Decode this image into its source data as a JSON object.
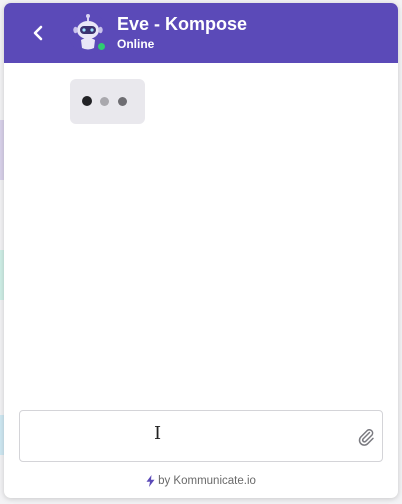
{
  "colors": {
    "header_bg": "#5b4ab8",
    "online": "#2ecc71"
  },
  "header": {
    "back_icon": "chevron-left-icon",
    "avatar_icon": "robot-icon",
    "title": "Eve - Kompose",
    "status": "Online"
  },
  "conversation": {
    "typing_indicator": "typing-dots"
  },
  "composer": {
    "placeholder": "",
    "value": "",
    "attach_icon": "paperclip-icon",
    "cursor_glyph": "I"
  },
  "footer": {
    "bolt_icon": "lightning-icon",
    "text": "by Kommunicate.io"
  }
}
